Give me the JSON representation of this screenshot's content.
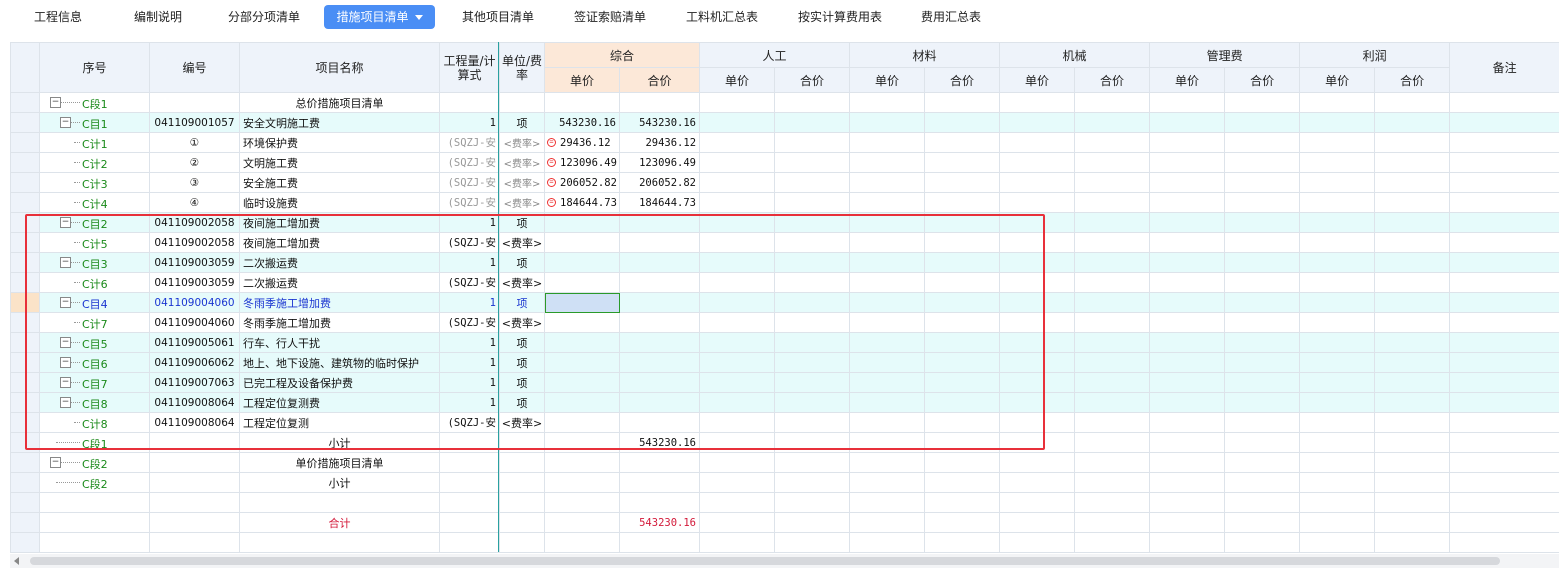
{
  "tabs": [
    {
      "label": "工程信息"
    },
    {
      "label": "编制说明"
    },
    {
      "label": "分部分项清单"
    },
    {
      "label": "措施项目清单"
    },
    {
      "label": "其他项目清单"
    },
    {
      "label": "签证索赔清单"
    },
    {
      "label": "工料机汇总表"
    },
    {
      "label": "按实计算费用表"
    },
    {
      "label": "费用汇总表"
    }
  ],
  "active_tab": "措施项目清单",
  "header": {
    "seq": "序号",
    "code": "编号",
    "name": "项目名称",
    "qty": "工程量/计算式",
    "unit": "单位/费率",
    "groups": [
      "综合",
      "人工",
      "材料",
      "机械",
      "管理费",
      "利润"
    ],
    "price": "单价",
    "total": "合价",
    "remark": "备注"
  },
  "rows": [
    {
      "seq": "C段1",
      "code": "",
      "name": "总价措施项目清单",
      "qty": "",
      "unit": "",
      "price": "",
      "total": ""
    },
    {
      "seq": "C目1",
      "code": "041109001057",
      "name": "安全文明施工费",
      "qty": "1",
      "unit": "项",
      "price": "543230.16",
      "total": "543230.16"
    },
    {
      "seq": "C计1",
      "code": "①",
      "name": "环境保护费",
      "qty": "(SQZJ-安",
      "unit": "<费率>",
      "price": "29436.12",
      "total": "29436.12"
    },
    {
      "seq": "C计2",
      "code": "②",
      "name": "文明施工费",
      "qty": "(SQZJ-安",
      "unit": "<费率>",
      "price": "123096.49",
      "total": "123096.49"
    },
    {
      "seq": "C计3",
      "code": "③",
      "name": "安全施工费",
      "qty": "(SQZJ-安",
      "unit": "<费率>",
      "price": "206052.82",
      "total": "206052.82"
    },
    {
      "seq": "C计4",
      "code": "④",
      "name": "临时设施费",
      "qty": "(SQZJ-安",
      "unit": "<费率>",
      "price": "184644.73",
      "total": "184644.73"
    },
    {
      "seq": "C目2",
      "code": "041109002058",
      "name": "夜间施工增加费",
      "qty": "1",
      "unit": "项",
      "price": "",
      "total": ""
    },
    {
      "seq": "C计5",
      "code": "041109002058",
      "name": "夜间施工增加费",
      "qty": "(SQZJ-安",
      "unit": "<费率>",
      "price": "",
      "total": ""
    },
    {
      "seq": "C目3",
      "code": "041109003059",
      "name": "二次搬运费",
      "qty": "1",
      "unit": "项",
      "price": "",
      "total": ""
    },
    {
      "seq": "C计6",
      "code": "041109003059",
      "name": "二次搬运费",
      "qty": "(SQZJ-安",
      "unit": "<费率>",
      "price": "",
      "total": ""
    },
    {
      "seq": "C目4",
      "code": "041109004060",
      "name": "冬雨季施工增加费",
      "qty": "1",
      "unit": "项",
      "price": "",
      "total": ""
    },
    {
      "seq": "C计7",
      "code": "041109004060",
      "name": "冬雨季施工增加费",
      "qty": "(SQZJ-安",
      "unit": "<费率>",
      "price": "",
      "total": ""
    },
    {
      "seq": "C目5",
      "code": "041109005061",
      "name": "行车、行人干扰",
      "qty": "1",
      "unit": "项",
      "price": "",
      "total": ""
    },
    {
      "seq": "C目6",
      "code": "041109006062",
      "name": "地上、地下设施、建筑物的临时保护",
      "qty": "1",
      "unit": "项",
      "price": "",
      "total": ""
    },
    {
      "seq": "C目7",
      "code": "041109007063",
      "name": "已完工程及设备保护费",
      "qty": "1",
      "unit": "项",
      "price": "",
      "total": ""
    },
    {
      "seq": "C目8",
      "code": "041109008064",
      "name": "工程定位复测费",
      "qty": "1",
      "unit": "项",
      "price": "",
      "total": ""
    },
    {
      "seq": "C计8",
      "code": "041109008064",
      "name": "工程定位复测",
      "qty": "(SQZJ-安",
      "unit": "<费率>",
      "price": "",
      "total": ""
    },
    {
      "seq": "C段1",
      "code": "",
      "name": "小计",
      "qty": "",
      "unit": "",
      "price": "",
      "total": "543230.16"
    },
    {
      "seq": "C段2",
      "code": "",
      "name": "单价措施项目清单",
      "qty": "",
      "unit": "",
      "price": "",
      "total": ""
    },
    {
      "seq": "C段2",
      "code": "",
      "name": "小计",
      "qty": "",
      "unit": "",
      "price": "",
      "total": ""
    },
    {
      "seq": "",
      "code": "",
      "name": "",
      "qty": "",
      "unit": "",
      "price": "",
      "total": ""
    },
    {
      "seq": "",
      "code": "",
      "name": "合计",
      "qty": "",
      "unit": "",
      "price": "",
      "total": "543230.16"
    },
    {
      "seq": "",
      "code": "",
      "name": "",
      "qty": "",
      "unit": "",
      "price": "",
      "total": ""
    }
  ],
  "colors": {
    "accent": "#4a8ef5",
    "highlight_box": "#e8303a",
    "row_cyan": "#e6fbfb",
    "tree_green": "#1a8a1a",
    "total_red": "#d31a3a",
    "selected_blue": "#1a35d0"
  }
}
